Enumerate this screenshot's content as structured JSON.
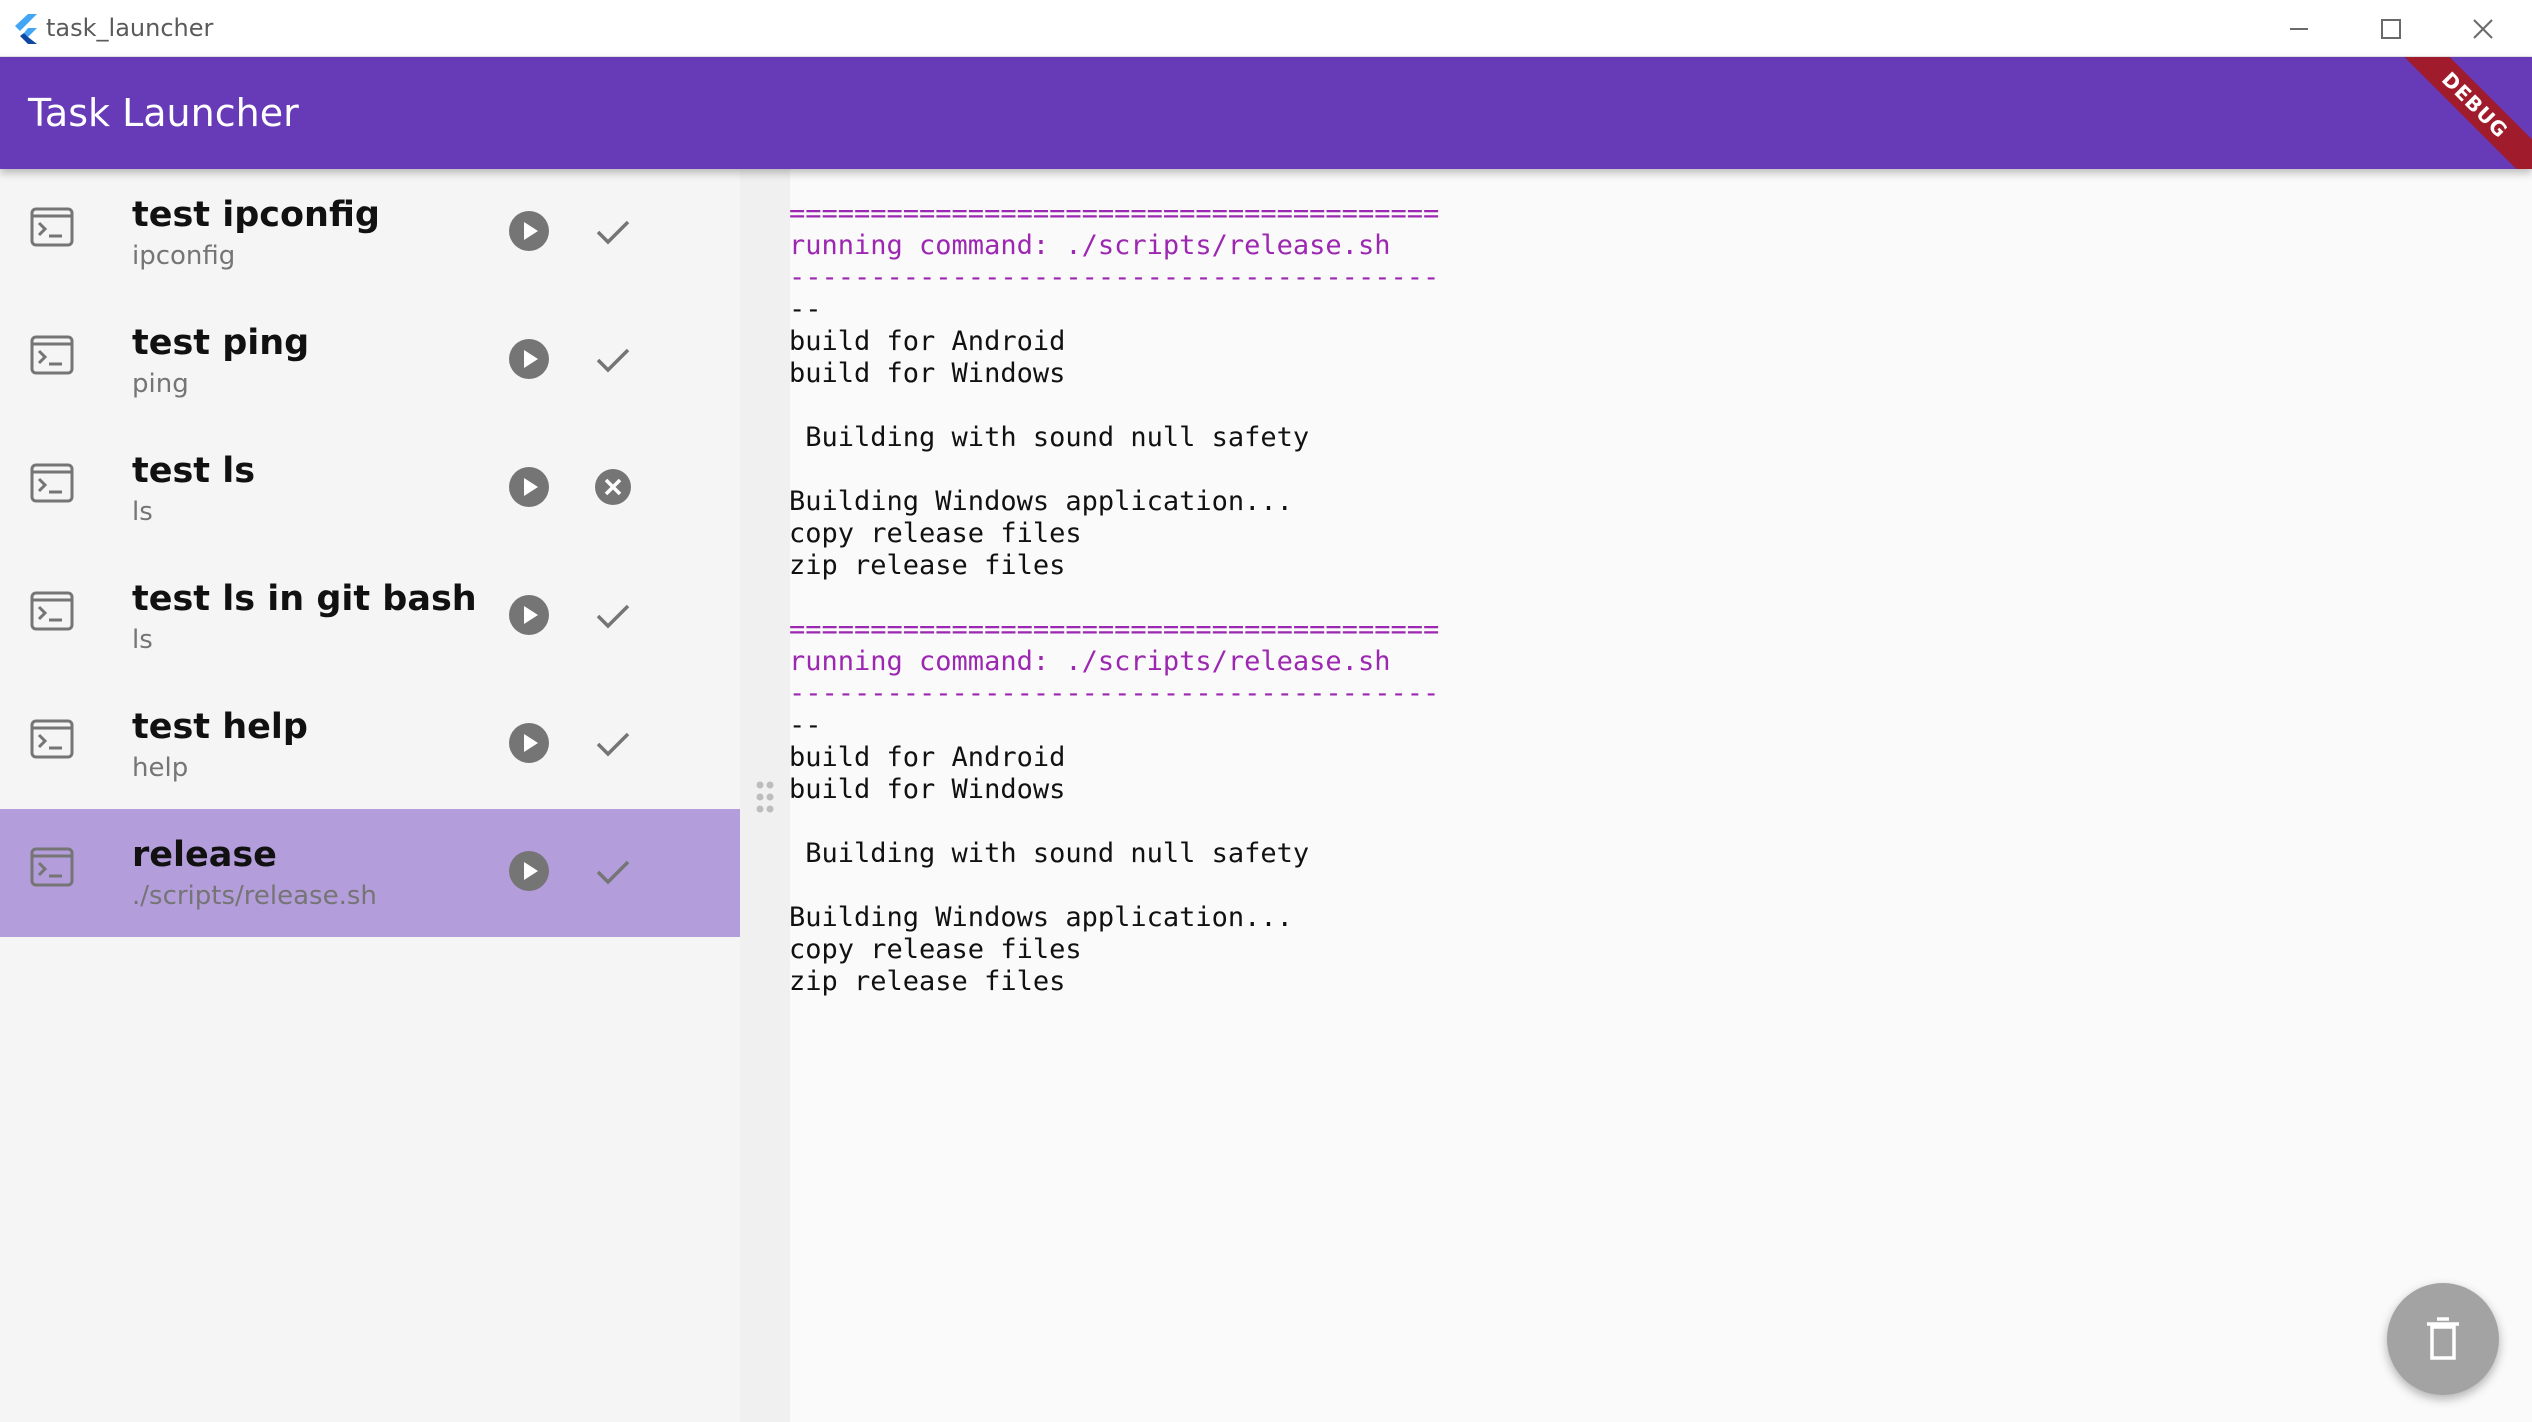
{
  "window": {
    "title": "task_launcher",
    "controls": [
      "minimize-icon",
      "maximize-icon",
      "close-icon"
    ]
  },
  "appbar": {
    "title": "Task Launcher",
    "debug_banner": "DEBUG",
    "color": "#673ab7"
  },
  "tasks": [
    {
      "name": "test ipconfig",
      "command": "ipconfig",
      "status": "success",
      "status_icon": "check-icon",
      "selected": false
    },
    {
      "name": "test ping",
      "command": "ping",
      "status": "success",
      "status_icon": "check-icon",
      "selected": false
    },
    {
      "name": "test ls",
      "command": "ls",
      "status": "error",
      "status_icon": "error-circle-icon",
      "selected": false
    },
    {
      "name": "test ls in git bash",
      "command": "ls",
      "status": "success",
      "status_icon": "check-icon",
      "selected": false
    },
    {
      "name": "test help",
      "command": "help",
      "status": "success",
      "status_icon": "check-icon",
      "selected": false
    },
    {
      "name": "release",
      "command": "./scripts/release.sh",
      "status": "success",
      "status_icon": "check-icon",
      "selected": true
    }
  ],
  "output": {
    "accent_color": "#9c27b0",
    "blocks": [
      {
        "separator": "========================================",
        "header": "running command: ./scripts/release.sh",
        "dashes": "----------------------------------------",
        "body": "--\nbuild for Android\nbuild for Windows\n\n Building with sound null safety\n\nBuilding Windows application...\ncopy release files\nzip release files"
      },
      {
        "separator": "========================================",
        "header": "running command: ./scripts/release.sh",
        "dashes": "----------------------------------------",
        "body": "--\nbuild for Android\nbuild for Windows\n\n Building with sound null safety\n\nBuilding Windows application...\ncopy release files\nzip release files"
      }
    ]
  },
  "fab": {
    "icon": "delete-icon"
  },
  "colors": {
    "selected_row": "#b39ddb",
    "icon_grey": "#757575",
    "fab": "#a3a3a3"
  }
}
